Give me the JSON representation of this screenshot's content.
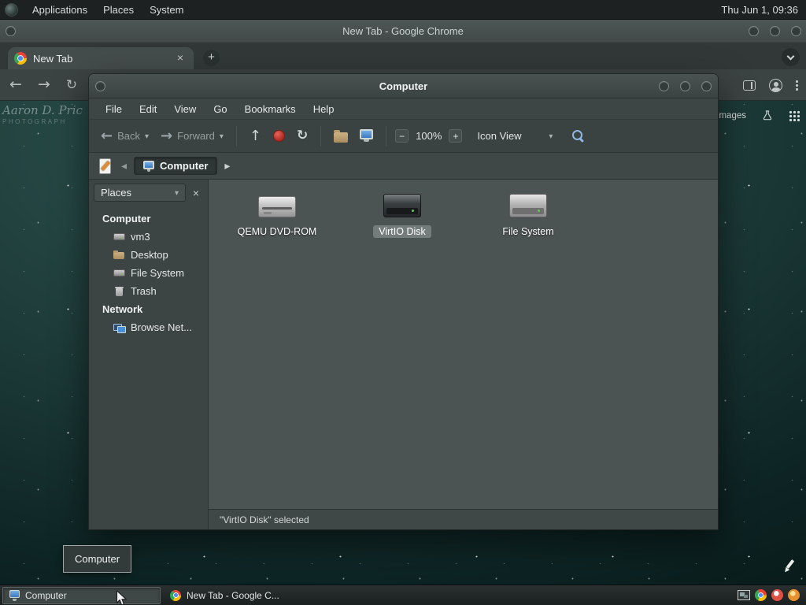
{
  "colors": {
    "selection_gray": "#757c7c",
    "stop_red": "#b02b22",
    "window_chrome": "#3e4545",
    "wallpaper_teal": "#1d3b39"
  },
  "panel": {
    "menus": [
      "Applications",
      "Places",
      "System"
    ],
    "clock": "Thu Jun 1, 09:36"
  },
  "chrome": {
    "window_title": "New Tab - Google Chrome",
    "tab_title": "New Tab",
    "page_links": {
      "images": "Images"
    }
  },
  "fm": {
    "window_title": "Computer",
    "menus": [
      "File",
      "Edit",
      "View",
      "Go",
      "Bookmarks",
      "Help"
    ],
    "toolbar": {
      "back": "Back",
      "forward": "Forward",
      "zoom_level": "100%",
      "view_mode": "Icon View"
    },
    "location": {
      "path": "Computer"
    },
    "sidebar": {
      "selector": "Places",
      "items": [
        {
          "label": "Computer",
          "icon": null,
          "header": true
        },
        {
          "label": "vm3",
          "icon": "drive-icon",
          "header": false
        },
        {
          "label": "Desktop",
          "icon": "folder-icon",
          "header": false
        },
        {
          "label": "File System",
          "icon": "drive-icon",
          "header": false
        },
        {
          "label": "Trash",
          "icon": "trash-icon",
          "header": false
        },
        {
          "label": "Network",
          "icon": null,
          "header": true
        },
        {
          "label": "Browse Net...",
          "icon": "network-icon",
          "header": false
        }
      ]
    },
    "files": [
      {
        "label": "QEMU DVD-ROM",
        "icon": "optical-drive-icon",
        "selected": false
      },
      {
        "label": "VirtIO Disk",
        "icon": "hard-disk-dark-icon",
        "selected": true
      },
      {
        "label": "File System",
        "icon": "hard-disk-icon",
        "selected": false
      }
    ],
    "status": "\"VirtIO Disk\" selected"
  },
  "desktop": {
    "taskbar_tooltip": "Computer",
    "watermark_line1": "Aaron D. Pric",
    "watermark_line2": "PHOTOGRAPH"
  },
  "taskbar": {
    "buttons": [
      {
        "label": "Computer",
        "active": true
      },
      {
        "label": "New Tab - Google C...",
        "active": false
      }
    ]
  }
}
